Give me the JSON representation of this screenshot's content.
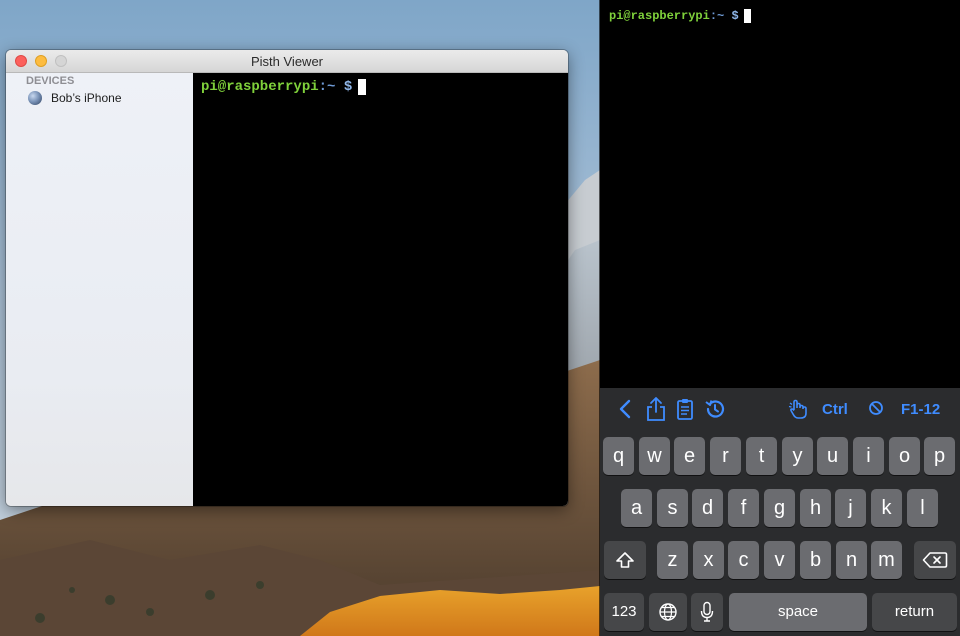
{
  "mac_window": {
    "title": "Pisth Viewer",
    "sidebar": {
      "header": "DEVICES",
      "devices": [
        {
          "label": "Bob’s iPhone",
          "icon": "globe-icon"
        }
      ]
    },
    "terminal": {
      "prompt_user": "pi@raspberrypi",
      "prompt_path": ":~",
      "prompt_symbol": "$"
    }
  },
  "ios_app": {
    "terminal": {
      "prompt_user": "pi@raspberrypi",
      "prompt_path": ":~",
      "prompt_symbol": "$"
    },
    "accessory_bar": {
      "icons": [
        "chevron-left-icon",
        "share-icon",
        "clipboard-icon",
        "history-icon",
        "hand-tap-icon",
        "compass-icon"
      ],
      "ctrl_label": "Ctrl",
      "fn_label": "F1-12"
    },
    "keyboard": {
      "row1": [
        "q",
        "w",
        "e",
        "r",
        "t",
        "y",
        "u",
        "i",
        "o",
        "p"
      ],
      "row2": [
        "a",
        "s",
        "d",
        "f",
        "g",
        "h",
        "j",
        "k",
        "l"
      ],
      "row3": [
        "z",
        "x",
        "c",
        "v",
        "b",
        "n",
        "m"
      ],
      "num_key": "123",
      "space_key": "space",
      "return_key": "return",
      "shift_icon": "shift-icon",
      "delete_icon": "delete-icon",
      "globe_icon": "globe-icon",
      "mic_icon": "microphone-icon"
    }
  },
  "colors": {
    "prompt_user": "#7fd13b",
    "prompt_path": "#6f9bd6",
    "accent": "#3f8cff",
    "key_light": "#6b6c70",
    "key_dark": "#464749"
  }
}
